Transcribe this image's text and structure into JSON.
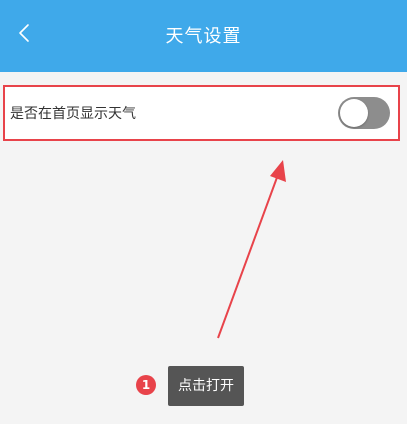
{
  "header": {
    "title": "天气设置",
    "back_icon": "chevron-left-icon"
  },
  "setting": {
    "label": "是否在首页显示天气",
    "toggle_state": "off"
  },
  "annotation": {
    "step_number": "1",
    "tip_text": "点击打开"
  },
  "colors": {
    "header_bg": "#3fa9ea",
    "highlight": "#e8434a",
    "toggle_off": "#8d8d8d",
    "tip_bg": "#555555"
  }
}
